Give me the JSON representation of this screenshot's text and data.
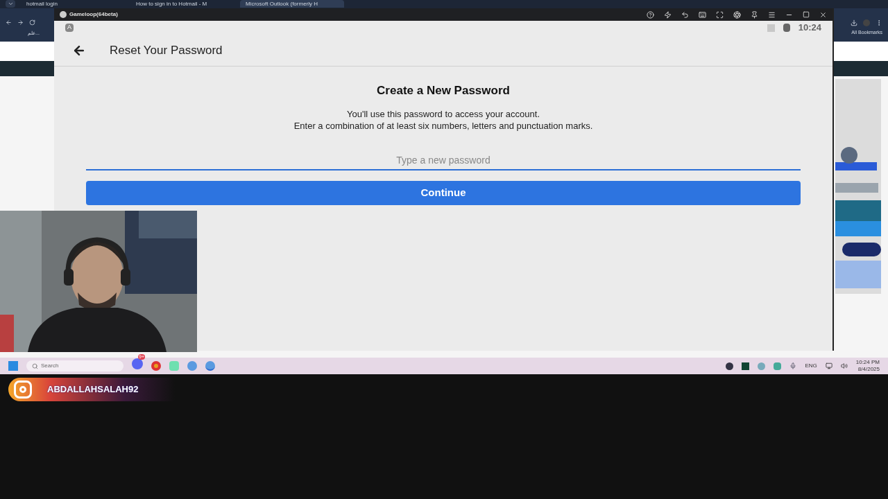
{
  "browser": {
    "tabs": [
      {
        "title": "hotmail login",
        "selected": false
      },
      {
        "title": "How to sign in to Hotmail - M",
        "selected": false
      },
      {
        "title": "Microsoft Outlook (formerly H",
        "selected": true
      }
    ],
    "bookmark": "علم...",
    "bookmarks_folder": "All Bookmarks"
  },
  "emulator": {
    "title": "Gameloop(64beta)",
    "clock": "10:24",
    "keyboard_key": "A",
    "header": "Reset Your Password",
    "heading": "Create a New Password",
    "lines": [
      "You'll use this password to access your account.",
      "Enter a combination of at least six numbers, letters and punctuation marks."
    ],
    "password_field": {
      "placeholder": "Type a new password"
    },
    "button": "Continue"
  },
  "taskbar": {
    "search_label": "Search",
    "discord_badge": "9+",
    "language": "ENG",
    "time": "10:24 PM",
    "date": "8/4/2025"
  },
  "social": {
    "handle": "ABDALLAHSALAH92"
  }
}
